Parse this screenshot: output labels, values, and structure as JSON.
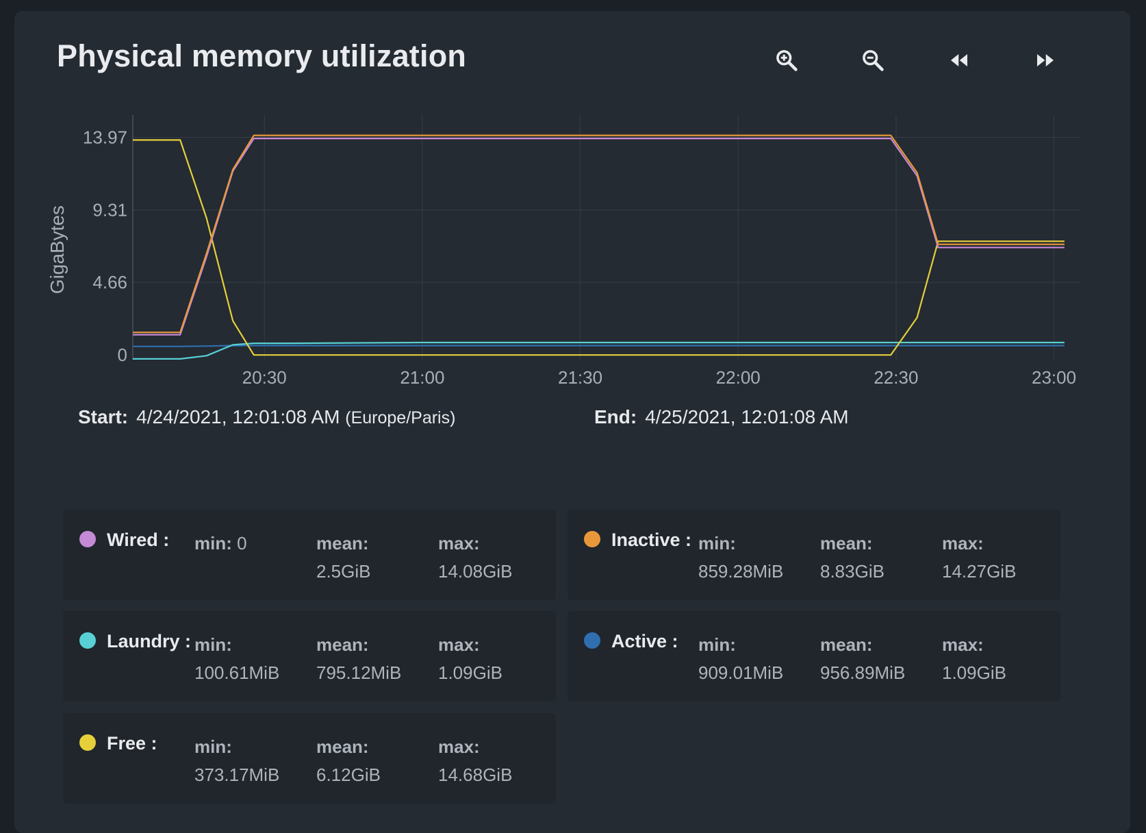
{
  "panel": {
    "title": "Physical memory utilization",
    "toolbar": {
      "zoom_in_icon": "zoom-in-icon",
      "zoom_out_icon": "zoom-out-icon",
      "back_icon": "rewind-icon",
      "forward_icon": "fast-forward-icon"
    }
  },
  "range": {
    "start_label": "Start:",
    "start_value": "4/24/2021, 12:01:08 AM",
    "start_tz": "(Europe/Paris)",
    "end_label": "End:",
    "end_value": "4/25/2021, 12:01:08 AM"
  },
  "chart_data": {
    "type": "line",
    "ylabel": "GigaBytes",
    "ylim": [
      -0.3,
      15.4
    ],
    "yticks": [
      0,
      4.66,
      9.31,
      13.97
    ],
    "ytick_labels": [
      "0",
      "4.66",
      "9.31",
      "13.97"
    ],
    "xlim": [
      "20:05",
      "23:05"
    ],
    "xticks": [
      "20:30",
      "21:00",
      "21:30",
      "22:00",
      "22:30",
      "23:00"
    ],
    "grid": true,
    "x": [
      "20:05",
      "20:14",
      "20:19",
      "20:24",
      "20:28",
      "20:35",
      "21:00",
      "21:30",
      "22:00",
      "22:25",
      "22:29",
      "22:34",
      "22:38",
      "22:45",
      "23:00",
      "23:02"
    ],
    "series": [
      {
        "name": "Wired",
        "color": "#c58ad6",
        "values": [
          1.3,
          1.3,
          6.3,
          11.8,
          13.9,
          13.9,
          13.9,
          13.9,
          13.9,
          13.9,
          13.9,
          11.5,
          6.9,
          6.9,
          6.9,
          6.9
        ]
      },
      {
        "name": "Inactive",
        "color": "#e8983a",
        "values": [
          1.45,
          1.45,
          6.5,
          11.9,
          14.1,
          14.1,
          14.1,
          14.1,
          14.1,
          14.1,
          14.1,
          11.7,
          7.1,
          7.1,
          7.1,
          7.1
        ]
      },
      {
        "name": "Laundry",
        "color": "#58d0d6",
        "values": [
          -0.25,
          -0.25,
          -0.05,
          0.65,
          0.75,
          0.75,
          0.8,
          0.8,
          0.8,
          0.8,
          0.8,
          0.8,
          0.8,
          0.8,
          0.8,
          0.8
        ]
      },
      {
        "name": "Active",
        "color": "#2f6fb0",
        "values": [
          0.55,
          0.55,
          0.57,
          0.6,
          0.6,
          0.6,
          0.6,
          0.6,
          0.6,
          0.6,
          0.6,
          0.6,
          0.6,
          0.6,
          0.6,
          0.6
        ]
      },
      {
        "name": "Free",
        "color": "#e6cf3a",
        "values": [
          13.8,
          13.8,
          8.8,
          2.2,
          0.0,
          0.0,
          0.0,
          0.0,
          0.0,
          0.0,
          0.0,
          2.4,
          7.3,
          7.3,
          7.3,
          7.3
        ]
      }
    ]
  },
  "legend": [
    {
      "name": "Wired :",
      "color": "#c58ad6",
      "min_label": "min:",
      "min": "0",
      "mean_label": "mean:",
      "mean": "2.5GiB",
      "max_label": "max:",
      "max": "14.08GiB"
    },
    {
      "name": "Inactive :",
      "color": "#e8983a",
      "min_label": "min:",
      "min": "859.28MiB",
      "mean_label": "mean:",
      "mean": "8.83GiB",
      "max_label": "max:",
      "max": "14.27GiB"
    },
    {
      "name": "Laundry :",
      "color": "#58d0d6",
      "min_label": "min:",
      "min": "100.61MiB",
      "mean_label": "mean:",
      "mean": "795.12MiB",
      "max_label": "max:",
      "max": "1.09GiB"
    },
    {
      "name": "Active :",
      "color": "#2f6fb0",
      "min_label": "min:",
      "min": "909.01MiB",
      "mean_label": "mean:",
      "mean": "956.89MiB",
      "max_label": "max:",
      "max": "1.09GiB"
    },
    {
      "name": "Free :",
      "color": "#e6cf3a",
      "min_label": "min:",
      "min": "373.17MiB",
      "mean_label": "mean:",
      "mean": "6.12GiB",
      "max_label": "max:",
      "max": "14.68GiB"
    }
  ]
}
